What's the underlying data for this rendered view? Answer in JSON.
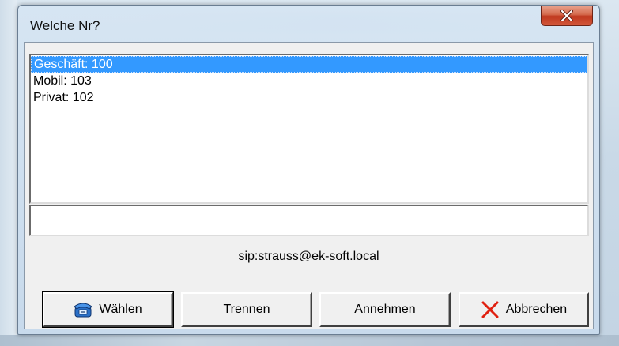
{
  "window": {
    "title": "Welche Nr?",
    "close_icon": "close-x-icon"
  },
  "numbers": {
    "items": [
      {
        "label": "Geschäft: 100",
        "selected": true
      },
      {
        "label": "Mobil: 103",
        "selected": false
      },
      {
        "label": "Privat: 102",
        "selected": false
      }
    ]
  },
  "input": {
    "value": "",
    "placeholder": ""
  },
  "sip_address": "sip:strauss@ek-soft.local",
  "buttons": {
    "dial": {
      "label": "Wählen",
      "icon": "telephone-icon"
    },
    "hangup": {
      "label": "Trennen"
    },
    "accept": {
      "label": "Annehmen"
    },
    "cancel": {
      "label": "Abbrechen",
      "icon": "red-x-icon"
    }
  },
  "colors": {
    "selection": "#3399ff",
    "close_button": "#c7432a",
    "cancel_icon": "#e02010"
  }
}
